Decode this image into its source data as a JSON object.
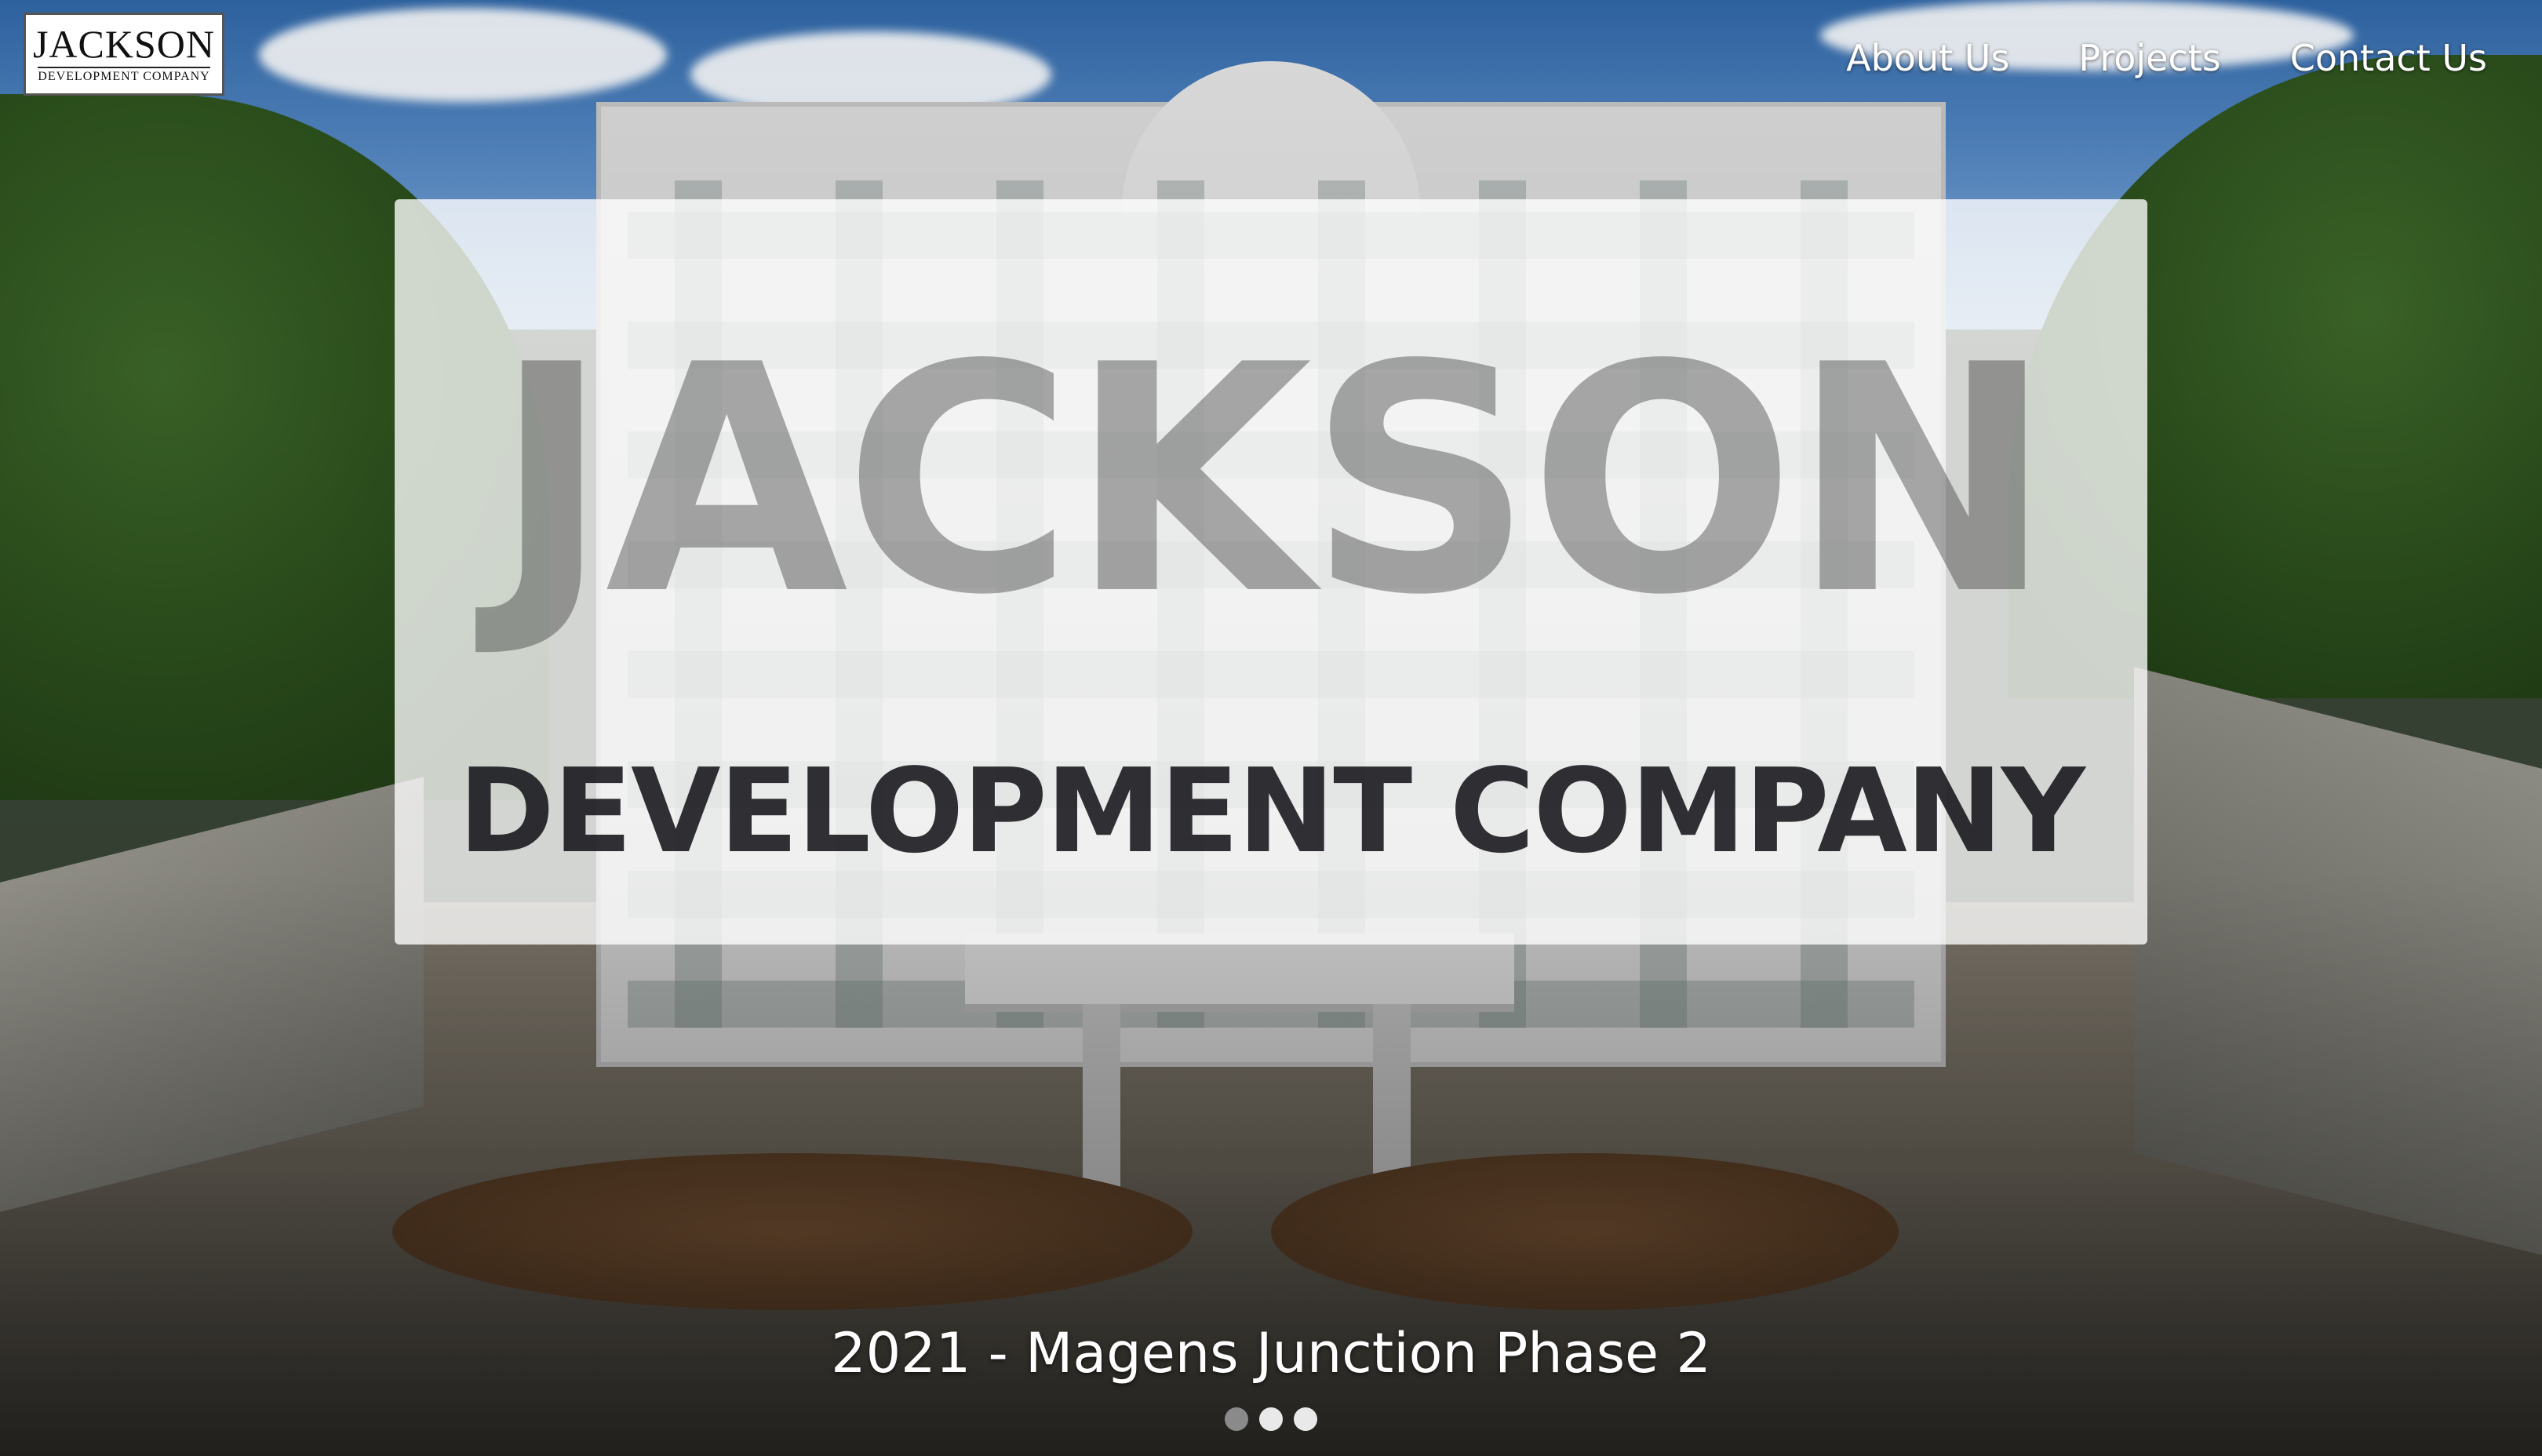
{
  "logo": {
    "name": "JACKSON",
    "tagline": "DEVELOPMENT COMPANY"
  },
  "nav": {
    "items": [
      {
        "label": "About Us"
      },
      {
        "label": "Projects"
      },
      {
        "label": "Contact Us"
      }
    ]
  },
  "hero": {
    "title": "JACKSON",
    "subtitle": "DEVELOPMENT COMPANY",
    "caption": "2021 - Magens Junction Phase 2"
  },
  "carousel": {
    "slide_count": 3,
    "active_index": 0
  },
  "colors": {
    "nav_text": "#ffffff",
    "overlay": "#ffffff",
    "dot_inactive": "#e9e9e9",
    "dot_active": "#8a8a8a"
  }
}
